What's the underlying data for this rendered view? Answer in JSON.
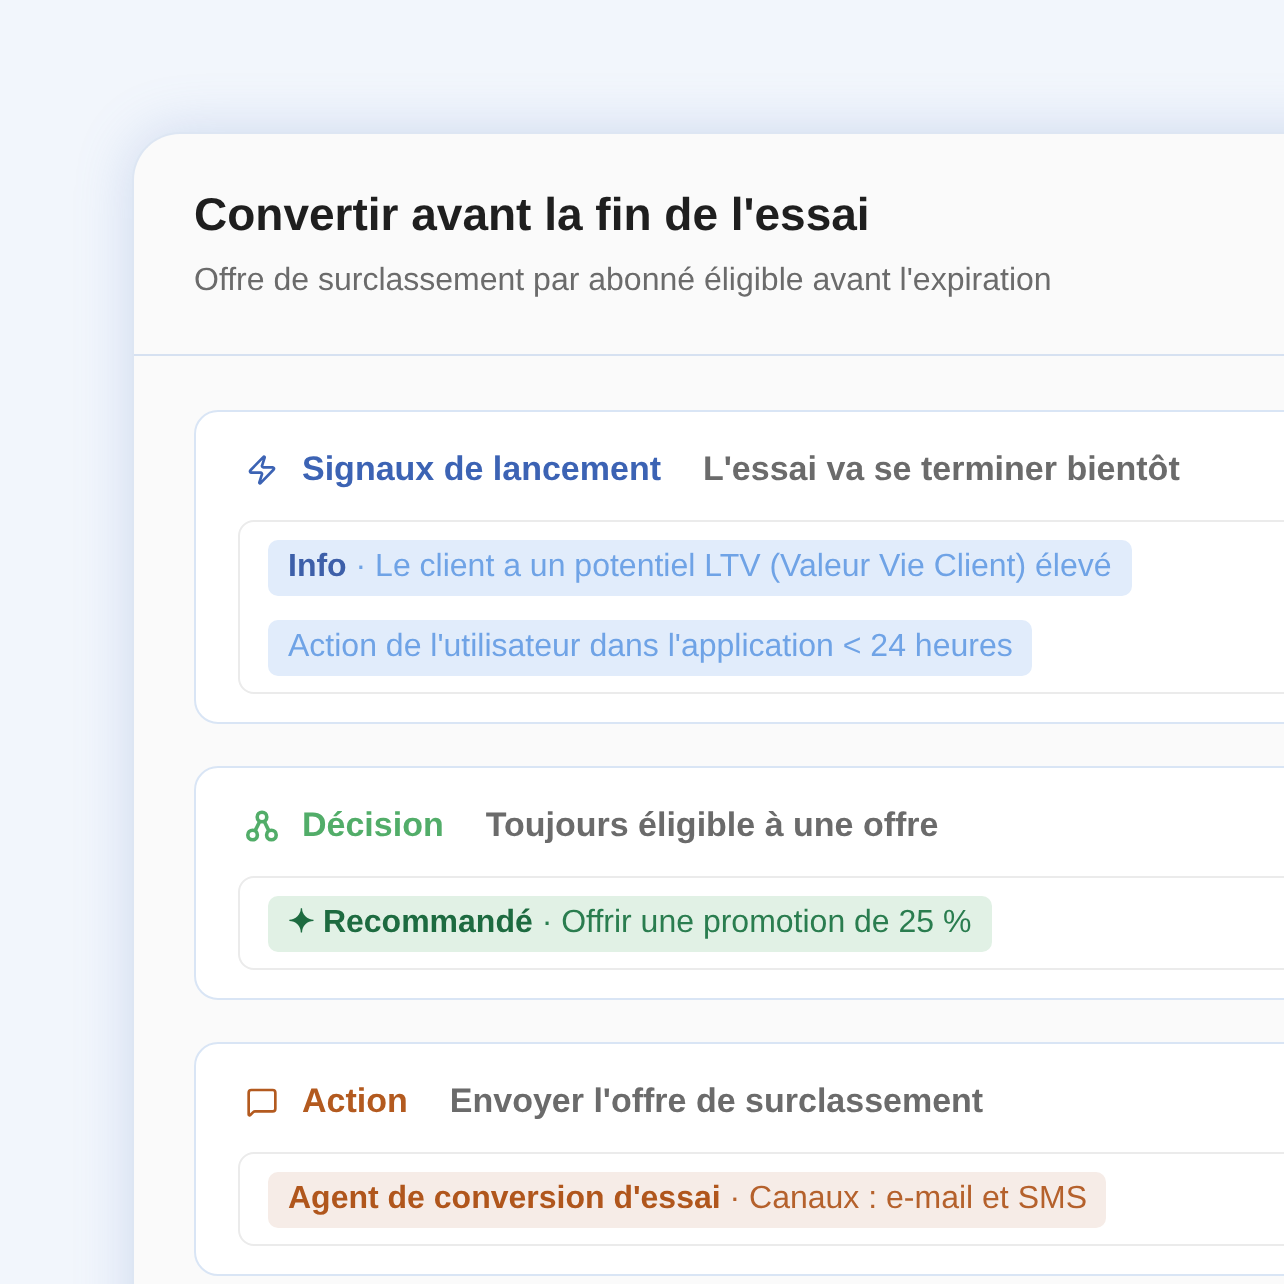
{
  "panel": {
    "title": "Convertir avant la fin de l'essai",
    "subtitle": "Offre de surclassement par abonné éligible avant l'expiration"
  },
  "sections": [
    {
      "kind": "trigger",
      "label": "Signaux de lancement",
      "description": "L'essai va se terminer bientôt",
      "tags": [
        "**Info** · Le client a un potentiel LTV (Valeur Vie Client) élevé",
        "Action de l'utilisateur dans l'application < 24 heures"
      ]
    },
    {
      "kind": "decision",
      "label": "Décision",
      "description": "Toujours éligible à une offre",
      "tags": [
        "**✦ Recommandé** · Offrir une promotion de 25 %"
      ]
    },
    {
      "kind": "action",
      "label": "Action",
      "description": "Envoyer l'offre de surclassement",
      "tags": [
        "**Agent de conversion d'essai** · Canaux : e-mail et SMS"
      ]
    }
  ]
}
